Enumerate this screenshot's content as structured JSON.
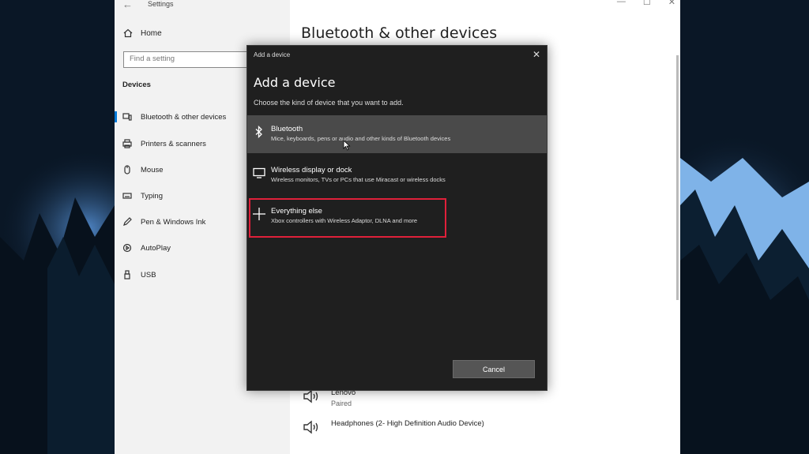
{
  "settings": {
    "title": "Settings",
    "nav": {
      "home_label": "Home",
      "search_placeholder": "Find a setting",
      "section": "Devices",
      "items": [
        {
          "label": "Bluetooth & other devices",
          "icon": "bluetooth-devices-icon",
          "selected": true
        },
        {
          "label": "Printers & scanners",
          "icon": "printer-icon",
          "selected": false
        },
        {
          "label": "Mouse",
          "icon": "mouse-icon",
          "selected": false
        },
        {
          "label": "Typing",
          "icon": "keyboard-icon",
          "selected": false
        },
        {
          "label": "Pen & Windows Ink",
          "icon": "pen-icon",
          "selected": false
        },
        {
          "label": "AutoPlay",
          "icon": "autoplay-icon",
          "selected": false
        },
        {
          "label": "USB",
          "icon": "usb-icon",
          "selected": false
        }
      ]
    },
    "content": {
      "title": "Bluetooth & other devices",
      "devices": [
        {
          "name": "Lenovo",
          "status": "Paired"
        },
        {
          "name": "Headphones (2- High Definition Audio Device)",
          "status": ""
        }
      ]
    }
  },
  "dialog": {
    "titlebar": "Add a device",
    "heading": "Add a device",
    "subtitle": "Choose the kind of device that you want to add.",
    "options": [
      {
        "title": "Bluetooth",
        "desc": "Mice, keyboards, pens or audio and other kinds of Bluetooth devices",
        "icon": "bluetooth-icon"
      },
      {
        "title": "Wireless display or dock",
        "desc": "Wireless monitors, TVs or PCs that use Miracast or wireless docks",
        "icon": "monitor-icon"
      },
      {
        "title": "Everything else",
        "desc": "Xbox controllers with Wireless Adaptor, DLNA and more",
        "icon": "plus-icon"
      }
    ],
    "cancel_label": "Cancel"
  },
  "colors": {
    "accent": "#0078d7",
    "highlight": "#e0203a",
    "dialog_bg": "#1f1f1f"
  }
}
